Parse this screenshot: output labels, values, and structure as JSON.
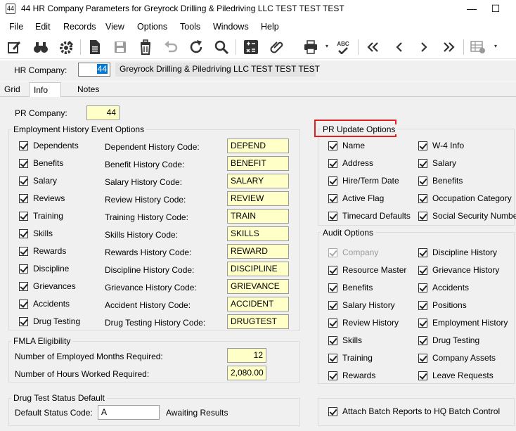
{
  "window": {
    "icon_label": "44",
    "title": "44 HR Company Parameters for Greyrock Drilling & Piledriving LLC TEST TEST TEST",
    "minimize": "—",
    "maximize": "☐"
  },
  "menu": [
    "File",
    "Edit",
    "Records",
    "View",
    "Options",
    "Tools",
    "Windows",
    "Help"
  ],
  "toolbar": {
    "icons": [
      "edit-icon",
      "binoculars-icon",
      "settings-icon",
      "document-icon",
      "save-icon",
      "delete-icon",
      "undo-icon",
      "refresh-icon",
      "search-icon",
      "calculator-icon",
      "attachment-icon",
      "print-icon",
      "spellcheck-icon",
      "first-record-icon",
      "previous-record-icon",
      "next-record-icon",
      "last-record-icon",
      "grid-icon"
    ],
    "spell_text": "ABC",
    "dropdown_glyph": "▾"
  },
  "hr_company": {
    "label": "HR Company:",
    "value": "44",
    "name": "Greyrock Drilling & Piledriving LLC TEST TEST TEST"
  },
  "tabs": [
    "Grid",
    "Info",
    "Notes"
  ],
  "pr_company": {
    "label": "PR Company:",
    "value": "44"
  },
  "employment_history": {
    "title": "Employment History Event Options",
    "rows": [
      {
        "check": "Dependents",
        "code_label": "Dependent History Code:",
        "code": "DEPEND"
      },
      {
        "check": "Benefits",
        "code_label": "Benefit History Code:",
        "code": "BENEFIT"
      },
      {
        "check": "Salary",
        "code_label": "Salary History Code:",
        "code": "SALARY"
      },
      {
        "check": "Reviews",
        "code_label": "Review History Code:",
        "code": "REVIEW"
      },
      {
        "check": "Training",
        "code_label": "Training History Code:",
        "code": "TRAIN"
      },
      {
        "check": "Skills",
        "code_label": "Skills History Code:",
        "code": "SKILLS"
      },
      {
        "check": "Rewards",
        "code_label": "Rewards History Code:",
        "code": "REWARD"
      },
      {
        "check": "Discipline",
        "code_label": "Discipline History Code:",
        "code": "DISCIPLINE"
      },
      {
        "check": "Grievances",
        "code_label": "Grievance History Code:",
        "code": "GRIEVANCE"
      },
      {
        "check": "Accidents",
        "code_label": "Accident History Code:",
        "code": "ACCIDENT"
      },
      {
        "check": "Drug Testing",
        "code_label": "Drug Testing History Code:",
        "code": "DRUGTEST"
      }
    ]
  },
  "fmla": {
    "title": "FMLA Eligibility",
    "months_label": "Number of Employed Months Required:",
    "months_value": "12",
    "hours_label": "Number of Hours Worked Required:",
    "hours_value": "2,080.00"
  },
  "drug_test": {
    "title": "Drug Test Status Default",
    "label": "Default Status Code:",
    "value": "A",
    "desc": "Awaiting Results"
  },
  "pr_update": {
    "title": "PR Update Options",
    "left": [
      "Name",
      "Address",
      "Hire/Term Date",
      "Active Flag",
      "Timecard Defaults"
    ],
    "right": [
      "W-4 Info",
      "Salary",
      "Benefits",
      "Occupation Category",
      "Social Security Number"
    ]
  },
  "audit": {
    "title": "Audit Options",
    "left": [
      "Company",
      "Resource Master",
      "Benefits",
      "Salary History",
      "Review History",
      "Skills",
      "Training",
      "Rewards"
    ],
    "right": [
      "Discipline  History",
      "Grievance  History",
      "Accidents",
      "Positions",
      "Employment  History",
      "Drug Testing",
      "Company Assets",
      "Leave Requests"
    ]
  },
  "attach_batch": "Attach Batch Reports to HQ Batch Control",
  "colors": {
    "highlight": "#e02020",
    "field_bg": "#ffffc8",
    "panel_bg": "#f0f0f0",
    "selection": "#0078d7"
  }
}
